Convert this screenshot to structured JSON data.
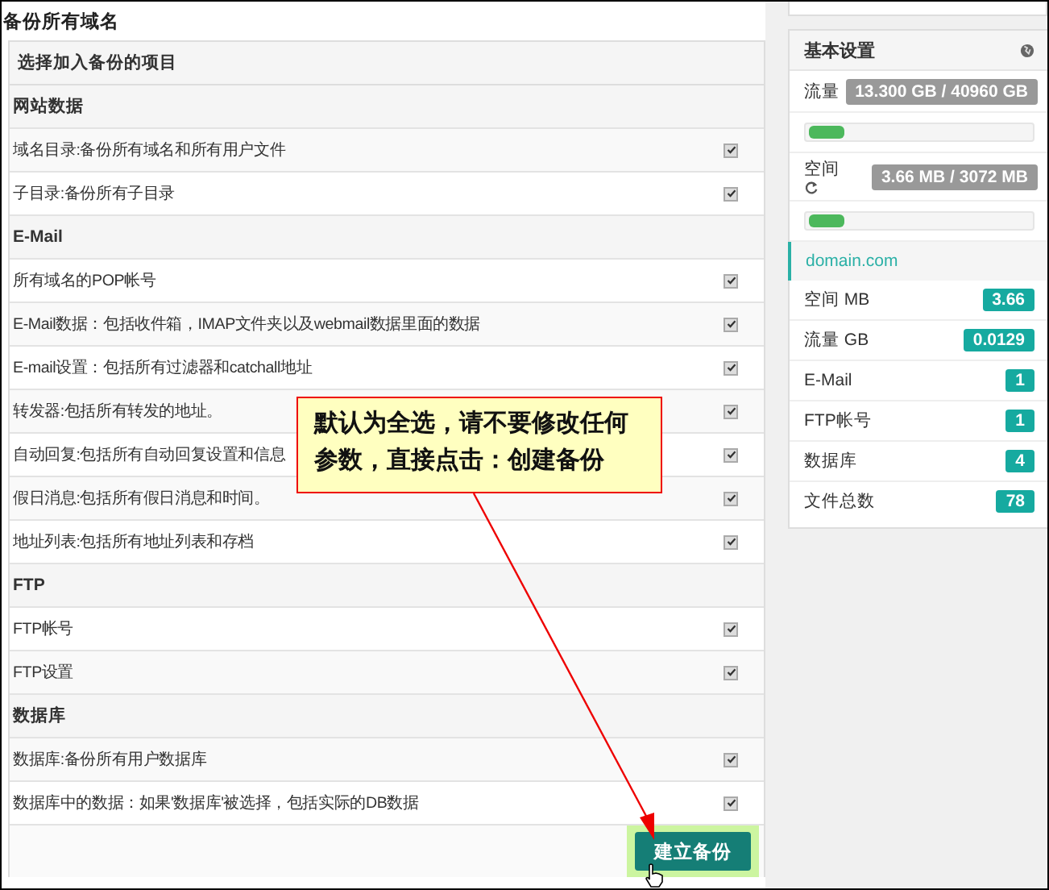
{
  "page_title": "备份所有域名",
  "backup_panel": {
    "heading": "选择加入备份的项目",
    "rows": [
      {
        "kind": "section",
        "label": "网站数据"
      },
      {
        "kind": "item",
        "label": "域名目录:备份所有域名和所有用户文件",
        "checked": true
      },
      {
        "kind": "item",
        "label": "子目录:备份所有子目录",
        "checked": true
      },
      {
        "kind": "section",
        "label": "E-Mail"
      },
      {
        "kind": "item",
        "label": "所有域名的POP帐号",
        "checked": true
      },
      {
        "kind": "item",
        "label": "E-Mail数据：包括收件箱，IMAP文件夹以及webmail数据里面的数据",
        "checked": true
      },
      {
        "kind": "item",
        "label": "E-mail设置：包括所有过滤器和catchall地址",
        "checked": true
      },
      {
        "kind": "item",
        "label": "转发器:包括所有转发的地址。",
        "checked": true
      },
      {
        "kind": "item",
        "label": "自动回复:包括所有自动回复设置和信息",
        "checked": true
      },
      {
        "kind": "item",
        "label": "假日消息:包括所有假日消息和时间。",
        "checked": true
      },
      {
        "kind": "item",
        "label": "地址列表:包括所有地址列表和存档",
        "checked": true
      },
      {
        "kind": "section",
        "label": "FTP"
      },
      {
        "kind": "item",
        "label": "FTP帐号",
        "checked": true
      },
      {
        "kind": "item",
        "label": "FTP设置",
        "checked": true
      },
      {
        "kind": "section",
        "label": "数据库"
      },
      {
        "kind": "item",
        "label": "数据库:备份所有用户数据库",
        "checked": true
      },
      {
        "kind": "item",
        "label": "数据库中的数据：如果'数据库'被选择，包括实际的DB数据",
        "checked": true
      }
    ],
    "button": "建立备份"
  },
  "annotation": {
    "text": "默认为全选，请不要修改任何参数，直接点击：创建备份"
  },
  "sidebar": {
    "title": "基本设置",
    "usage": [
      {
        "label": "流量",
        "value": "13.300 GB / 40960 GB",
        "level": 0.16,
        "refresh_icon": false
      },
      {
        "label": "空间",
        "value": "3.66 MB / 3072 MB",
        "level": 0.16,
        "refresh_icon": true
      }
    ],
    "domain": "domain.com",
    "stats": [
      {
        "label": "空间 MB",
        "value": "3.66"
      },
      {
        "label": "流量 GB",
        "value": "0.0129"
      },
      {
        "label": "E-Mail",
        "value": "1"
      },
      {
        "label": "FTP帐号",
        "value": "1"
      },
      {
        "label": "数据库",
        "value": "4"
      },
      {
        "label": "文件总数",
        "value": "78"
      }
    ]
  }
}
